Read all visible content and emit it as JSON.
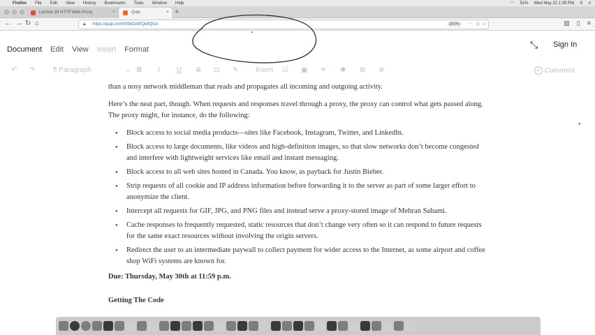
{
  "menubar": {
    "items": [
      "Firefox",
      "File",
      "Edit",
      "View",
      "History",
      "Bookmarks",
      "Tools",
      "Window",
      "Help"
    ],
    "battery": "51%",
    "clock": "Wed May 22  1:35 PM"
  },
  "browser": {
    "tabs": [
      {
        "label": "Lecture 16 HTTP Web Proxy"
      },
      {
        "label": "Quip"
      }
    ],
    "url": "https://quip.com/lS9eDAI0Qe8QUu",
    "zoom": "150%"
  },
  "quip": {
    "menu": {
      "document": "Document",
      "edit": "Edit",
      "view": "View",
      "insert": "Insert",
      "format": "Format"
    },
    "sign_in": "Sign In",
    "toolbar": {
      "paragraph": "Paragraph",
      "insert": "Insert",
      "comment": "Comment"
    }
  },
  "document": {
    "fragment": "than a nosy network middleman that reads and propagates all incoming and outgoing activity.",
    "intro": "Here’s the neat part, though.  When requests and responses travel through a proxy, the proxy can control what gets passed along.  The proxy might, for instance, do the following:",
    "bullets": [
      "Block access to social media products—sites like Facebook, Instagram, Twitter, and LinkedIn.",
      "Block access to large documents, like videos and high-definition images, so that slow networks don’t become congested and interfere with lightweight services like email and instant messaging.",
      "Block access to all web sites hosted in Canada.  You know, as payback for Justin Bieber.",
      "Strip requests of all cookie and IP address information before forwarding it to the server as part of some larger effort to anonymize the client.",
      "Intercept all requests for GIF, JPG, and PNG files and instead serve a proxy-stored image of Mehran Sahami.",
      "Cache responses to frequently requested, static resources that don’t change very often so it can respond to future requests for the same exact resources without involving the origin servers.",
      "Redirect the user to an intermediate paywall to collect payment for wider access to the Internet, as some airport and coffee shop WiFi systems are known for."
    ],
    "due": "Due: Thursday, May 30th at 11:59 p.m.",
    "heading": "Getting The Code"
  }
}
